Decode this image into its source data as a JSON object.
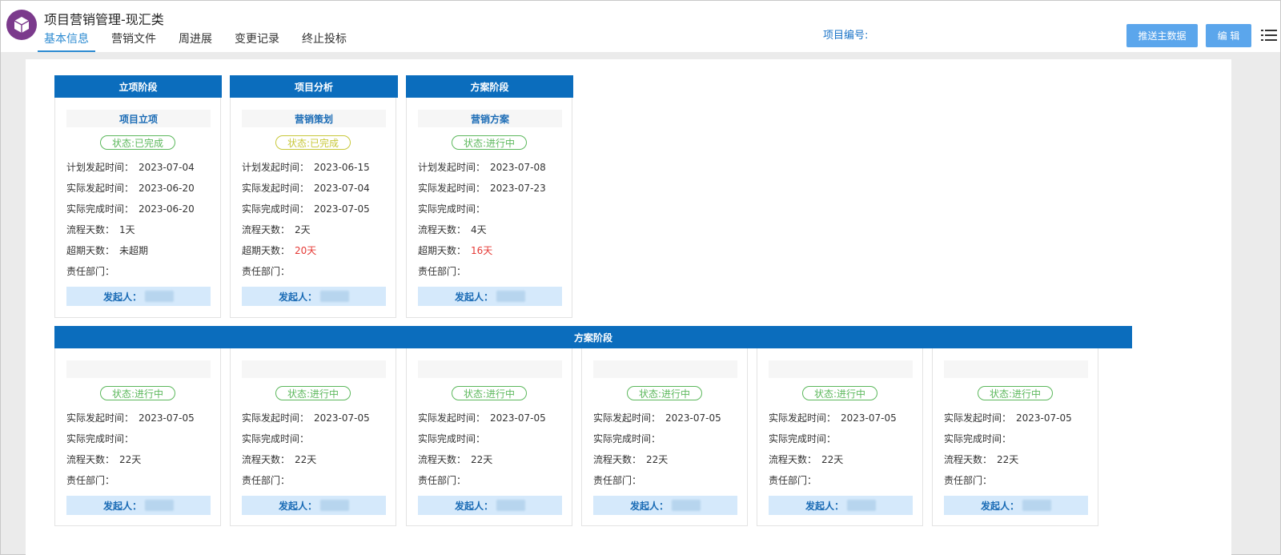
{
  "header": {
    "title": "项目营销管理-现汇类",
    "tabs": [
      "基本信息",
      "营销文件",
      "周进展",
      "变更记录",
      "终止投标"
    ],
    "project_no_label": "项目编号:",
    "push_button": "推送主数据",
    "edit_button": "编 辑"
  },
  "labels": {
    "plan_start": "计划发起时间：",
    "actual_start": "实际发起时间：",
    "actual_done": "实际完成时间：",
    "process_days": "流程天数：",
    "overdue_days": "超期天数：",
    "dept": "责任部门：",
    "initiator": "发起人："
  },
  "colors": {
    "accent": "#0b6dbd",
    "status_green": "#5cb85c",
    "status_yellow": "#c8c83a",
    "overdue_red": "#e53935"
  },
  "row1": [
    {
      "stage": "立项阶段",
      "card_title": "项目立项",
      "status": "状态:已完成",
      "plan_start": "2023-07-04",
      "actual_start": "2023-06-20",
      "actual_done": "2023-06-20",
      "process_days": "1天",
      "overdue": "未超期",
      "dept": ""
    },
    {
      "stage": "项目分析",
      "card_title": "营销策划",
      "status": "状态:已完成",
      "plan_start": "2023-06-15",
      "actual_start": "2023-07-04",
      "actual_done": "2023-07-05",
      "process_days": "2天",
      "overdue": "20天",
      "dept": ""
    },
    {
      "stage": "方案阶段",
      "card_title": "营销方案",
      "status": "状态:进行中",
      "plan_start": "2023-07-08",
      "actual_start": "2023-07-23",
      "actual_done": "",
      "process_days": "4天",
      "overdue": "16天",
      "dept": ""
    }
  ],
  "row2": {
    "stage": "方案阶段",
    "cards": [
      {
        "status": "状态:进行中",
        "actual_start": "2023-07-05",
        "actual_done": "",
        "process_days": "22天",
        "dept": ""
      },
      {
        "status": "状态:进行中",
        "actual_start": "2023-07-05",
        "actual_done": "",
        "process_days": "22天",
        "dept": ""
      },
      {
        "status": "状态:进行中",
        "actual_start": "2023-07-05",
        "actual_done": "",
        "process_days": "22天",
        "dept": ""
      },
      {
        "status": "状态:进行中",
        "actual_start": "2023-07-05",
        "actual_done": "",
        "process_days": "22天",
        "dept": ""
      },
      {
        "status": "状态:进行中",
        "actual_start": "2023-07-05",
        "actual_done": "",
        "process_days": "22天",
        "dept": ""
      },
      {
        "status": "状态:进行中",
        "actual_start": "2023-07-05",
        "actual_done": "",
        "process_days": "22天",
        "dept": ""
      }
    ]
  }
}
